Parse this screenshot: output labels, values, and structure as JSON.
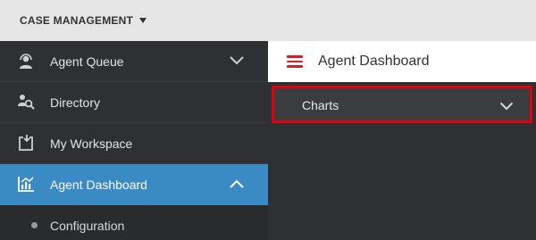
{
  "topbar": {
    "app_menu_label": "CASE MANAGEMENT"
  },
  "sidebar": {
    "items": [
      {
        "label": "Agent Queue",
        "icon": "agent-icon",
        "expanded": false
      },
      {
        "label": "Directory",
        "icon": "directory-search-icon"
      },
      {
        "label": "My Workspace",
        "icon": "workspace-icon"
      },
      {
        "label": "Agent Dashboard",
        "icon": "dashboard-chart-icon",
        "expanded": true,
        "active": true
      }
    ],
    "sub_items": [
      {
        "label": "Configuration"
      }
    ]
  },
  "main": {
    "title": "Agent Dashboard",
    "charts_panel": {
      "label": "Charts",
      "expanded": false
    }
  },
  "colors": {
    "active_nav": "#3a8ac4",
    "sidebar_bg": "#2e3033",
    "accent_red": "#d3202a",
    "highlight_border": "#e0000c"
  }
}
